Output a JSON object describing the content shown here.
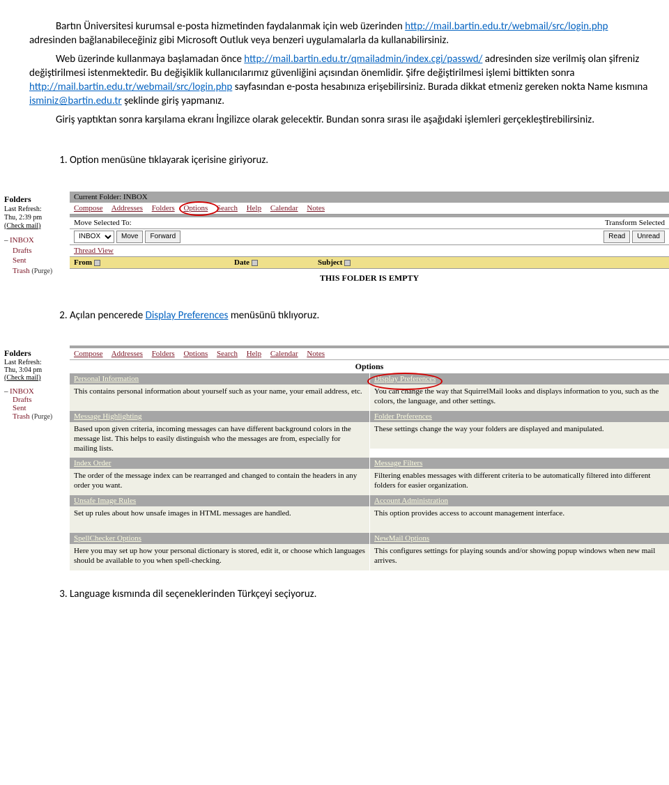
{
  "intro": {
    "p1_pre": "Bartın Üniversitesi kurumsal e-posta hizmetinden faydalanmak için web üzerinden ",
    "link1": "http://mail.bartin.edu.tr/webmail/src/login.php",
    "p1_post": " adresinden bağlanabileceğiniz gibi Microsoft Outluk veya benzeri uygulamalarla da kullanabilirsiniz.",
    "p2_pre": "Web üzerinde kullanmaya başlamadan önce ",
    "link2": "http://mail.bartin.edu.tr/qmailadmin/index.cgi/passwd/",
    "p2_post1": " adresinden size verilmiş olan şifreniz değiştirilmesi istenmektedir. Bu değişiklik kullanıcılarımız güvenliğini açısından önemlidir. Şifre değiştirilmesi işlemi bittikten sonra ",
    "link3": "http://mail.bartin.edu.tr/webmail/src/login.php",
    "p2_post2": " sayfasından e-posta hesabınıza erişebilirsiniz. Burada dikkat etmeniz gereken nokta Name kısmına ",
    "mail": "isminiz@bartin.edu.tr",
    "p2_post3": " şeklinde giriş yapmanız.",
    "p3": "Giriş yaptıktan sonra karşılama ekranı İngilizce olarak gelecektir. Bundan sonra sırası ile aşağıdaki işlemleri gerçekleştirebilirsiniz."
  },
  "steps": {
    "s1": "Option menüsüne tıklayarak içerisine giriyoruz.",
    "s2_pre": "Açılan pencerede ",
    "s2_link": "Display Preferences",
    "s2_post": " menüsünü tıklıyoruz.",
    "s3": "Language kısmında dil seçeneklerinden Türkçeyi seçiyoruz."
  },
  "shot1": {
    "sidebar": {
      "title": "Folders",
      "refresh1": "Last Refresh:",
      "refresh2": "Thu, 2:39 pm",
      "check": "(Check mail)",
      "f": {
        "inbox": "INBOX",
        "drafts": "Drafts",
        "sent": "Sent",
        "trash": "Trash",
        "purge": "(Purge)"
      }
    },
    "currentFolder": "Current Folder: INBOX",
    "menu": {
      "compose": "Compose",
      "addresses": "Addresses",
      "folders": "Folders",
      "options": "Options",
      "search": "Search",
      "help": "Help",
      "calendar": "Calendar",
      "notes": "Notes"
    },
    "move": {
      "label": "Move Selected To:",
      "select": "INBOX",
      "btnMove": "Move",
      "btnForward": "Forward",
      "rightLabel": "Transform Selected",
      "btnRead": "Read",
      "btnUnread": "Unread"
    },
    "threadView": "Thread View",
    "cols": {
      "from": "From",
      "date": "Date",
      "subject": "Subject"
    },
    "empty": "THIS FOLDER IS EMPTY"
  },
  "shot2": {
    "sidebar": {
      "title": "Folders",
      "refresh1": "Last Refresh:",
      "refresh2": "Thu, 3:04 pm",
      "check": "(Check mail)",
      "f": {
        "inbox": "INBOX",
        "drafts": "Drafts",
        "sent": "Sent",
        "trash": "Trash",
        "purge": "(Purge)"
      }
    },
    "menu": {
      "compose": "Compose",
      "addresses": "Addresses",
      "folders": "Folders",
      "options": "Options",
      "search": "Search",
      "help": "Help",
      "calendar": "Calendar",
      "notes": "Notes"
    },
    "optionsTitle": "Options",
    "opts": [
      {
        "l_head": "Personal Information",
        "l_body": "This contains personal information about yourself such as your name, your email address, etc.",
        "r_head": "Display Preferences",
        "r_body": "You can change the way that SquirrelMail looks and displays information to you, such as the colors, the language, and other settings."
      },
      {
        "l_head": "Message Highlighting",
        "l_body": "Based upon given criteria, incoming messages can have different background colors in the message list. This helps to easily distinguish who the messages are from, especially for mailing lists.",
        "r_head": "Folder Preferences",
        "r_body": "These settings change the way your folders are displayed and manipulated."
      },
      {
        "l_head": "Index Order",
        "l_body": "The order of the message index can be rearranged and changed to contain the headers in any order you want.",
        "r_head": "Message Filters",
        "r_body": "Filtering enables messages with different criteria to be automatically filtered into different folders for easier organization."
      },
      {
        "l_head": "Unsafe Image Rules",
        "l_body": "Set up rules about how unsafe images in HTML messages are handled.",
        "r_head": "Account Administration",
        "r_body": "This option provides access to account management interface."
      },
      {
        "l_head": "SpellChecker Options",
        "l_body": "Here you may set up how your personal dictionary is stored, edit it, or choose which languages should be available to you when spell-checking.",
        "r_head": "NewMail Options",
        "r_body": "This configures settings for playing sounds and/or showing popup windows when new mail arrives."
      }
    ]
  }
}
